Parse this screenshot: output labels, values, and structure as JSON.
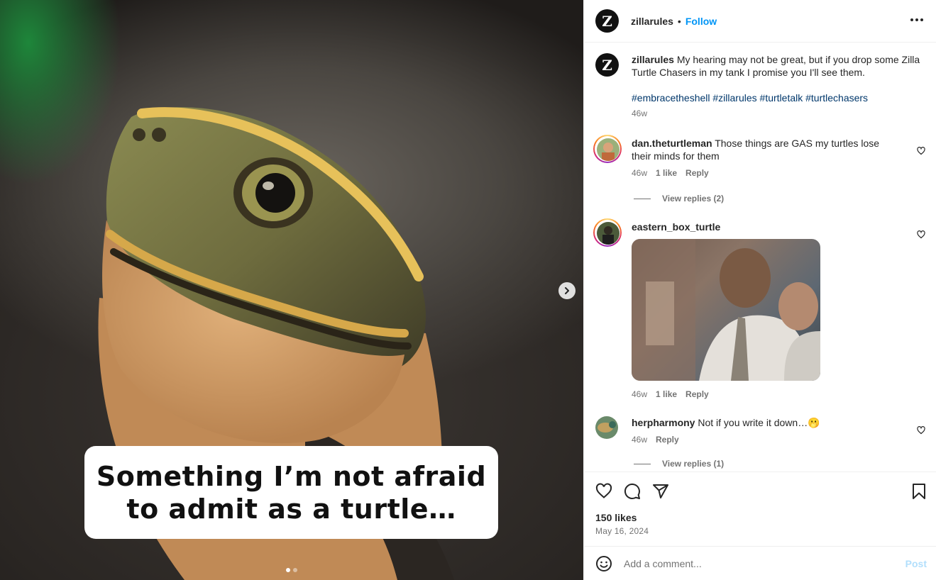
{
  "media": {
    "caption": "Something I’m not afraid\nto admit as a turtle…",
    "slide_count": 2,
    "active_slide": 1
  },
  "header": {
    "logo_letter": "Z",
    "username": "zillarules",
    "separator": "•",
    "follow_label": "Follow"
  },
  "post_caption": {
    "username": "zillarules",
    "text": "My hearing may not be great, but if you drop some Zilla Turtle Chasers in my tank I promise you I'll see them.",
    "hashtags": "#embracetheshell #zillarules #turtletalk #turtlechasers",
    "time": "46w"
  },
  "comments": [
    {
      "username": "dan.theturtleman",
      "text": "Those things are GAS my turtles lose their minds for them",
      "time": "46w",
      "likes": "1 like",
      "reply": "Reply",
      "view_replies": "View replies (2)"
    },
    {
      "username": "eastern_box_turtle",
      "text": "",
      "time": "46w",
      "likes": "1 like",
      "reply": "Reply"
    },
    {
      "username": "herpharmony",
      "text": "Not if you write it down…🫢",
      "time": "46w",
      "reply": "Reply",
      "view_replies": "View replies (1)"
    }
  ],
  "actions": {
    "likes": "150 likes",
    "date": "May 16, 2024"
  },
  "add_comment": {
    "placeholder": "Add a comment...",
    "post_label": "Post"
  },
  "colors": {
    "link_blue": "#0095f6",
    "hashtag": "#00376b",
    "muted": "#737373",
    "post_disabled": "#b2dffc"
  }
}
